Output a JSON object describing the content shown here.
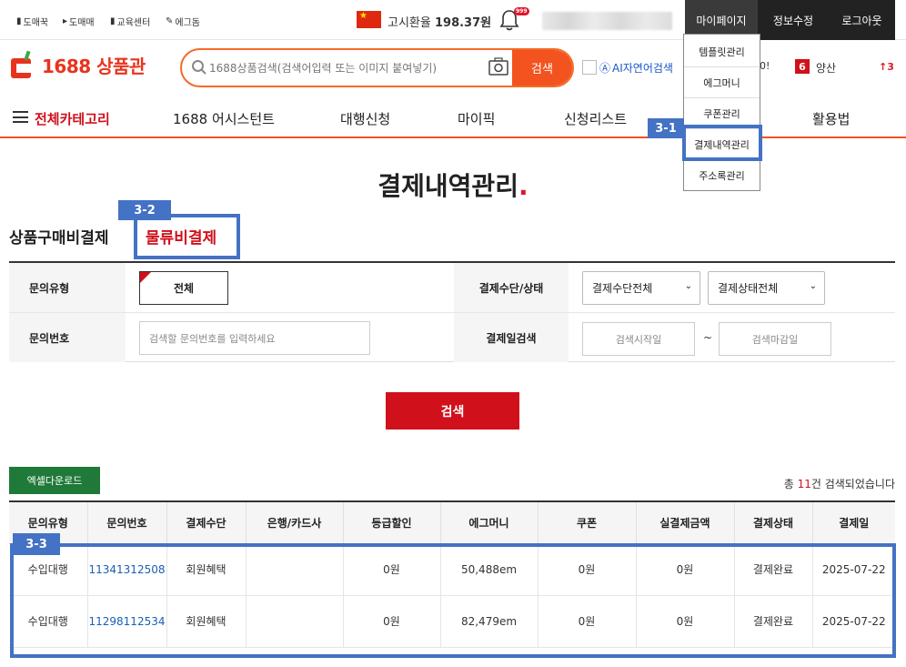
{
  "topbar": {
    "links": [
      {
        "icon": "도",
        "label": "도매꾹"
      },
      {
        "icon": "D",
        "label": "도매매"
      },
      {
        "icon": "C",
        "label": "교육센터"
      },
      {
        "icon": "e",
        "label": "에그돔"
      }
    ],
    "exchange_label": "고시환율",
    "exchange_value": "198.37원",
    "bell_badge": "999",
    "buttons": [
      {
        "label": "마이페이지"
      },
      {
        "label": "정보수정"
      },
      {
        "label": "로그아웃"
      }
    ]
  },
  "header": {
    "logo_text": "1688 상품관",
    "search_placeholder": "1688상품검색(검색어입력 또는 이미지 붙여넣기)",
    "search_button": "검색",
    "ai_label": "AI자연어검색",
    "truncated_text": "0!",
    "rank_number": "6",
    "rank_name": "양산",
    "rank_change": "↑3"
  },
  "nav": {
    "items": [
      {
        "label": "전체카테고리"
      },
      {
        "label": "1688 어시스턴트"
      },
      {
        "label": "대행신청"
      },
      {
        "label": "마이픽"
      },
      {
        "label": "신청리스트"
      },
      {
        "label": "활용법"
      }
    ]
  },
  "dropdown": {
    "items": [
      {
        "label": "템플릿관리"
      },
      {
        "label": "에그머니"
      },
      {
        "label": "쿠폰관리"
      },
      {
        "label": "결제내역관리"
      },
      {
        "label": "주소록관리"
      }
    ]
  },
  "annotations": {
    "a1": "3-1",
    "a2": "3-2",
    "a3": "3-3"
  },
  "page": {
    "title": "결제내역관리",
    "title_dot": ".",
    "tab_main": "상품구매비결제",
    "tab_sub": "물류비결제"
  },
  "filter": {
    "inquiry_type_label": "문의유형",
    "inquiry_type_value": "전체",
    "inquiry_no_label": "문의번호",
    "inquiry_no_placeholder": "검색할 문의번호를 입력하세요",
    "payment_label": "결제수단/상태",
    "payment_method": "결제수단전체",
    "payment_status": "결제상태전체",
    "date_label": "결제일검색",
    "date_start": "검색시작일",
    "date_sep": "~",
    "date_end": "검색마감일"
  },
  "actions": {
    "search": "검색",
    "excel": "엑셀다운로드",
    "total_prefix": "총 ",
    "total_count": "11",
    "total_suffix": "건 검색되었습니다"
  },
  "table": {
    "headers": [
      "문의유형",
      "문의번호",
      "결제수단",
      "은행/카드사",
      "등급할인",
      "에그머니",
      "쿠폰",
      "실결제금액",
      "결제상태",
      "결제일"
    ],
    "rows": [
      [
        "수입대행",
        "11341312508",
        "회원혜택",
        "",
        "0원",
        "50,488em",
        "0원",
        "0원",
        "결제완료",
        "2025-07-22"
      ],
      [
        "수입대행",
        "11298112534",
        "회원혜택",
        "",
        "0원",
        "82,479em",
        "0원",
        "0원",
        "결제완료",
        "2025-07-22"
      ]
    ]
  },
  "colors": {
    "brand_orange": "#f3531f",
    "brand_red": "#d0101b",
    "annotation_blue": "#4472c4",
    "excel_green": "#1f7a3a"
  }
}
